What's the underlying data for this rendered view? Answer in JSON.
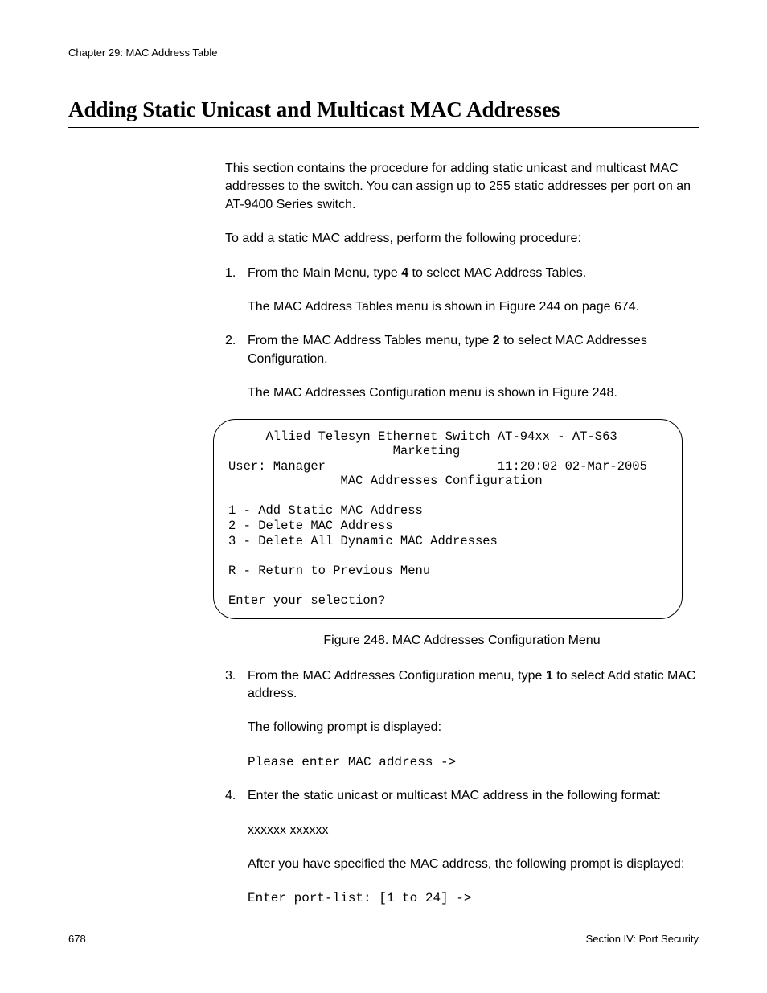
{
  "chapter_header": "Chapter 29: MAC Address Table",
  "section_title": "Adding Static Unicast and Multicast MAC Addresses",
  "intro_para": "This section contains the procedure for adding static unicast and multicast MAC addresses to the switch. You can assign up to 255 static addresses per port on an AT-9400 Series switch.",
  "lead_para": "To add a static MAC address, perform the following procedure:",
  "step1_pre": "From the Main Menu, type ",
  "step1_bold": "4",
  "step1_post": " to select MAC Address Tables.",
  "step1_body": "The MAC Address Tables menu is shown in Figure 244 on page 674.",
  "step2_pre": "From the MAC Address Tables menu, type ",
  "step2_bold": "2",
  "step2_post": " to select MAC Addresses Configuration.",
  "step2_body": "The MAC Addresses Configuration menu is shown in Figure 248.",
  "terminal": "     Allied Telesyn Ethernet Switch AT-94xx - AT-S63\n                      Marketing\nUser: Manager                       11:20:02 02-Mar-2005\n               MAC Addresses Configuration\n\n1 - Add Static MAC Address\n2 - Delete MAC Address\n3 - Delete All Dynamic MAC Addresses\n\nR - Return to Previous Menu\n\nEnter your selection?",
  "figure_caption": "Figure 248. MAC Addresses Configuration Menu",
  "step3_pre": "From the MAC Addresses Configuration menu, type ",
  "step3_bold": "1",
  "step3_post": " to select Add static MAC address.",
  "step3_body1": "The following prompt is displayed:",
  "step3_prompt": "Please enter MAC address ->",
  "step4_line": "Enter the static unicast or multicast MAC address in the following format:",
  "step4_format": "xxxxxx xxxxxx",
  "step4_body2": "After you have specified the MAC address, the following prompt is displayed:",
  "step4_prompt": "Enter port-list: [1 to 24] ->",
  "footer_left": "678",
  "footer_right": "Section IV: Port Security"
}
